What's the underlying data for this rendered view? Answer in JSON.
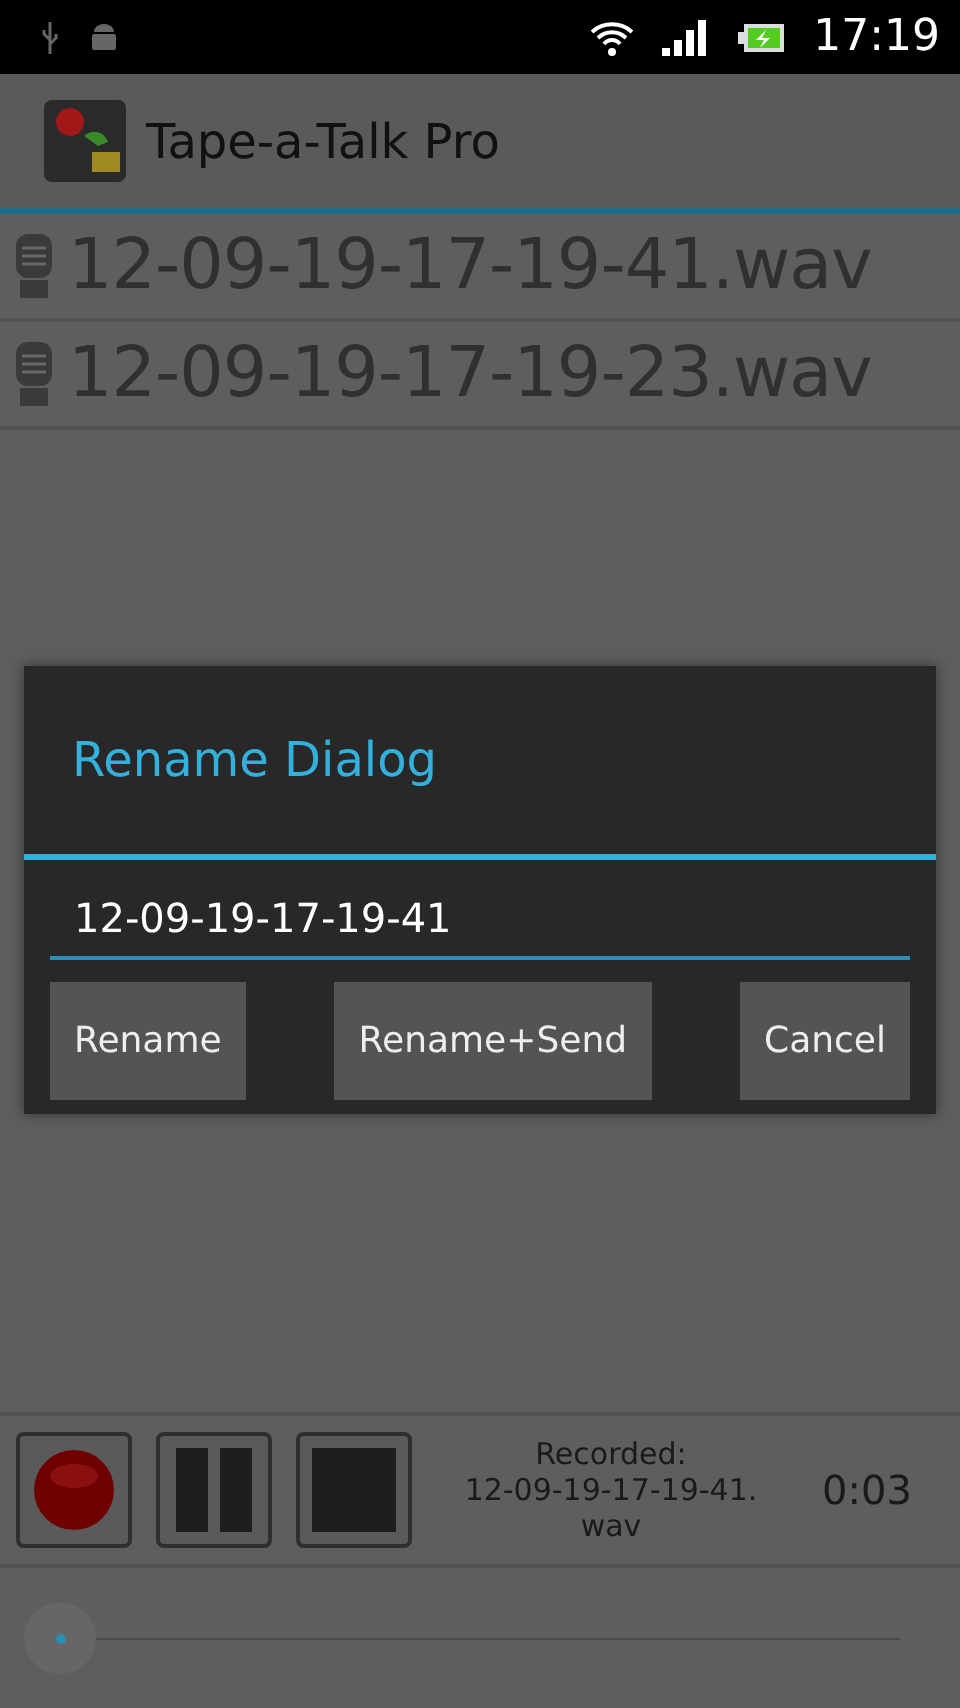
{
  "status_bar": {
    "time": "17:19"
  },
  "action_bar": {
    "title": "Tape-a-Talk Pro"
  },
  "recordings": [
    {
      "name": "12-09-19-17-19-41.wav"
    },
    {
      "name": "12-09-19-17-19-23.wav"
    }
  ],
  "dialog": {
    "title": "Rename Dialog",
    "field_value": "12-09-19-17-19-41",
    "buttons": [
      "Rename",
      "Rename+Send",
      "Cancel"
    ]
  },
  "player": {
    "status_label": "Recorded:",
    "status_file": "12-09-19-17-19-41.\nwav",
    "elapsed": "0:03",
    "seek": {
      "level": 0
    }
  }
}
